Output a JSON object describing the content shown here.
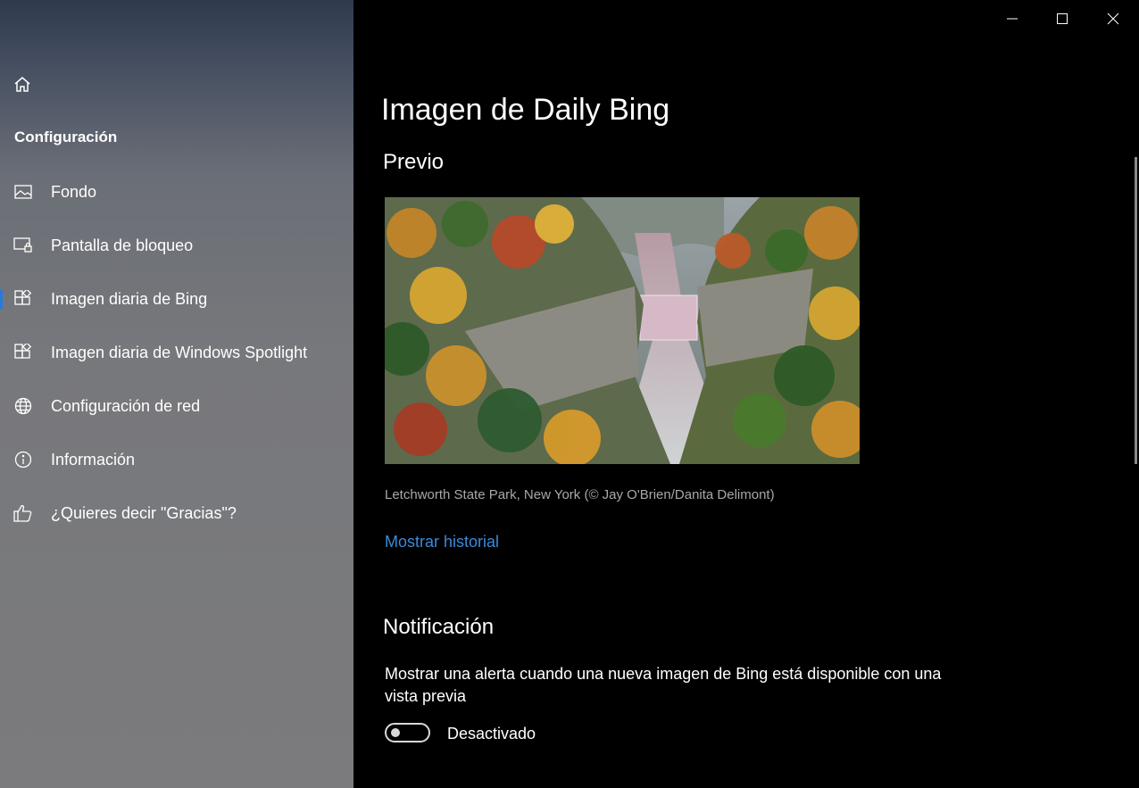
{
  "sidebar": {
    "section_title": "Configuración",
    "items": [
      {
        "label": "Fondo",
        "icon": "image-icon"
      },
      {
        "label": "Pantalla de bloqueo",
        "icon": "lock-screen-icon"
      },
      {
        "label": "Imagen diaria de Bing",
        "icon": "bing-image-icon",
        "selected": true
      },
      {
        "label": "Imagen diaria de Windows Spotlight",
        "icon": "spotlight-image-icon"
      },
      {
        "label": "Configuración de red",
        "icon": "globe-icon"
      },
      {
        "label": "Información",
        "icon": "info-icon"
      },
      {
        "label": "¿Quieres decir \"Gracias\"?",
        "icon": "thumbs-up-icon"
      }
    ]
  },
  "main": {
    "title": "Imagen de Daily Bing",
    "preview": {
      "heading": "Previo",
      "caption": "Letchworth State Park, New York (© Jay O'Brien/Danita Delimont)",
      "history_link": "Mostrar historial"
    },
    "notification": {
      "heading": "Notificación",
      "description": "Mostrar una alerta cuando una nueva imagen de Bing está disponible con una vista previa",
      "toggle_state": "Desactivado",
      "toggle_on": false
    }
  },
  "colors": {
    "accent": "#2b79d8",
    "link": "#3b8ad9",
    "background": "#000000"
  }
}
